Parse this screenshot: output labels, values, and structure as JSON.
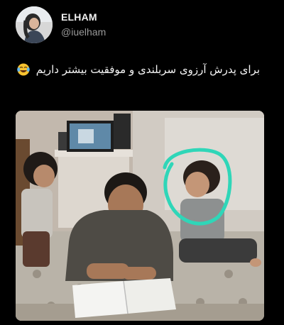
{
  "tweet": {
    "author": {
      "display_name": "ELHAM",
      "handle": "@iuelham",
      "avatar_icon": "profile-avatar-icon"
    },
    "text": "برای پدرش آرزوی سربلندی و موفقیت بیشتر داریم",
    "emoji_icon": "face-with-tears-of-joy-icon",
    "media": {
      "type": "photo",
      "icon": "photo-of-father-studying-on-floor-with-children"
    }
  },
  "colors": {
    "background": "#000000",
    "display_name": "#f2f2f2",
    "handle": "#9a9a9a",
    "highlight_circle": "#2fd6b8"
  }
}
